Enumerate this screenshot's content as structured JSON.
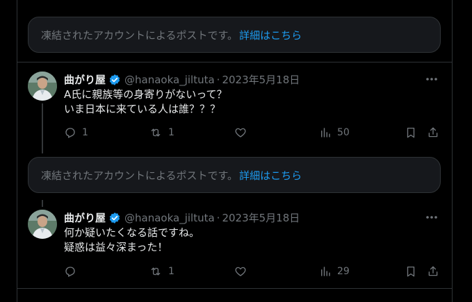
{
  "notices": [
    {
      "text": "凍結されたアカウントによるポストです。",
      "link": "詳細はこちら"
    },
    {
      "text": "凍結されたアカウントによるポストです。",
      "link": "詳細はこちら"
    }
  ],
  "posts": [
    {
      "display_name": "曲がり屋",
      "handle": "@hanaoka_jiltuta",
      "separator": "·",
      "date": "2023年5月18日",
      "lines": [
        "A氏に親族等の身寄りがないって？",
        "いま日本に来ている人は誰？？？"
      ],
      "reply_count": "1",
      "repost_count": "1",
      "like_count": "",
      "view_count": "50"
    },
    {
      "display_name": "曲がり屋",
      "handle": "@hanaoka_jiltuta",
      "separator": "·",
      "date": "2023年5月18日",
      "lines": [
        "何か疑いたくなる話ですね。",
        "疑惑は益々深まった！"
      ],
      "reply_count": "",
      "repost_count": "1",
      "like_count": "",
      "view_count": "29"
    }
  ],
  "colors": {
    "background": "#000000",
    "border": "#2f3336",
    "muted": "#71767b",
    "link": "#1d9bf0",
    "text": "#e7e9ea"
  },
  "icons": [
    "verified-badge-icon",
    "more-icon",
    "reply-icon",
    "repost-icon",
    "like-icon",
    "views-icon",
    "bookmark-icon",
    "share-icon"
  ]
}
